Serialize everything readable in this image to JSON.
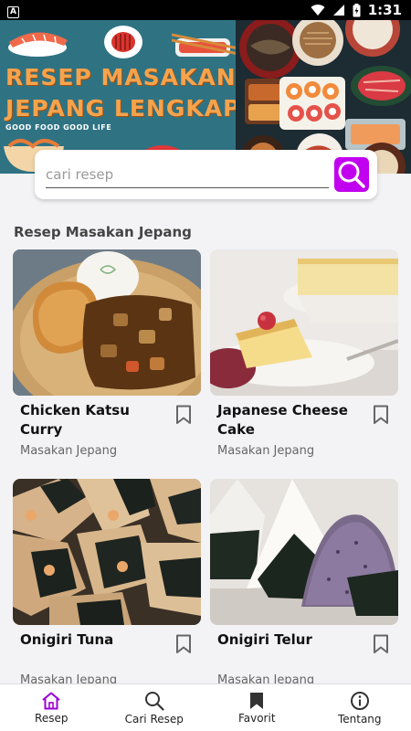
{
  "status_bar": {
    "notification_badge": "A",
    "time": "1:31"
  },
  "banner": {
    "title_line1": "RESEP MASAKAN",
    "title_line2": "JEPANG LENGKAP",
    "tagline": "GOOD FOOD GOOD LIFE"
  },
  "search": {
    "placeholder": "cari resep",
    "button_icon": "search-icon",
    "accent_color": "#c200f0"
  },
  "section": {
    "title": "Resep Masakan Jepang"
  },
  "recipes": [
    {
      "name": "Chicken Katsu Curry",
      "category": "Masakan Jepang",
      "bookmark_icon": "bookmark-outline-icon"
    },
    {
      "name": "Japanese Cheese Cake",
      "category": "Masakan Jepang",
      "bookmark_icon": "bookmark-outline-icon"
    },
    {
      "name": "Onigiri Tuna",
      "category": "Masakan Jepang",
      "bookmark_icon": "bookmark-outline-icon"
    },
    {
      "name": "Onigiri Telur",
      "category": "Masakan Jepang",
      "bookmark_icon": "bookmark-outline-icon"
    }
  ],
  "bottom_nav": {
    "items": [
      {
        "label": "Resep",
        "icon": "home-icon",
        "active": true
      },
      {
        "label": "Cari Resep",
        "icon": "search-icon",
        "active": false
      },
      {
        "label": "Favorit",
        "icon": "bookmark-icon",
        "active": false
      },
      {
        "label": "Tentang",
        "icon": "info-icon",
        "active": false
      }
    ],
    "active_color": "#9b00d6"
  }
}
